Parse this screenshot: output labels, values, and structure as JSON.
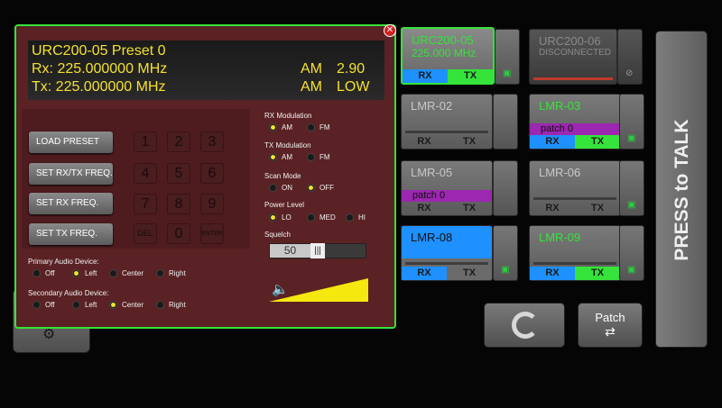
{
  "panel": {
    "display": {
      "title": "URC200-05 Preset 0",
      "rx_line": "Rx:  225.000000 MHz",
      "tx_line": "Tx:  225.000000 MHz",
      "rx_mod": "AM",
      "rx_val": "2.90",
      "tx_mod": "AM",
      "tx_val": "LOW"
    },
    "buttons": {
      "load_preset": "LOAD PRESET",
      "set_rxtx": "SET RX/TX FREQ.",
      "set_rx": "SET RX FREQ.",
      "set_tx": "SET TX FREQ."
    },
    "keypad": [
      "1",
      "2",
      "3",
      "4",
      "5",
      "6",
      "7",
      "8",
      "9",
      "DEL",
      "0",
      "ENTER"
    ],
    "primary_audio": {
      "label": "Primary Audio Device:",
      "options": [
        "Off",
        "Left",
        "Center",
        "Right"
      ],
      "selected": "Left"
    },
    "secondary_audio": {
      "label": "Secondary Audio Device:",
      "options": [
        "Off",
        "Left",
        "Center",
        "Right"
      ],
      "selected": "Center"
    },
    "rx_modulation": {
      "label": "RX Modulation",
      "options": [
        "AM",
        "FM"
      ],
      "selected": "AM"
    },
    "tx_modulation": {
      "label": "TX Modulation",
      "options": [
        "AM",
        "FM"
      ],
      "selected": "AM"
    },
    "scan_mode": {
      "label": "Scan Mode",
      "options": [
        "ON",
        "OFF"
      ],
      "selected": "OFF"
    },
    "power_level": {
      "label": "Power Level",
      "options": [
        "LO",
        "MED",
        "HI"
      ],
      "selected": "LO"
    },
    "squelch": {
      "label": "Squelch",
      "value": "50",
      "handle": "|||"
    }
  },
  "radios": [
    {
      "name": "URC200-05",
      "sub": "225.000 MHz",
      "rx": "RX",
      "tx": "TX",
      "state": "active"
    },
    {
      "name": "URC200-06",
      "sub": "DISCONNECTED",
      "state": "disconnected"
    },
    {
      "name": "LMR-02",
      "rx": "RX",
      "tx": "TX"
    },
    {
      "name": "LMR-03",
      "patch": "patch 0",
      "rx": "RX",
      "tx": "TX",
      "state": "tx-green"
    },
    {
      "name": "LMR-05",
      "patch": "patch 0",
      "rx": "RX",
      "tx": "TX"
    },
    {
      "name": "LMR-06",
      "rx": "RX",
      "tx": "TX"
    },
    {
      "name": "LMR-08",
      "rx": "RX",
      "tx": "TX",
      "state": "selected"
    },
    {
      "name": "LMR-09",
      "rx": "RX",
      "tx": "TX",
      "state": "tx-green"
    }
  ],
  "controls": {
    "patch": "Patch",
    "ptt": "PRESS to TALK"
  },
  "colors": {
    "accent_green": "#35e33a",
    "rx_blue": "#1e90ff",
    "patch_purple": "#9c27b0",
    "display_yellow": "#f5e12b",
    "panel_bg": "#5a2224"
  }
}
